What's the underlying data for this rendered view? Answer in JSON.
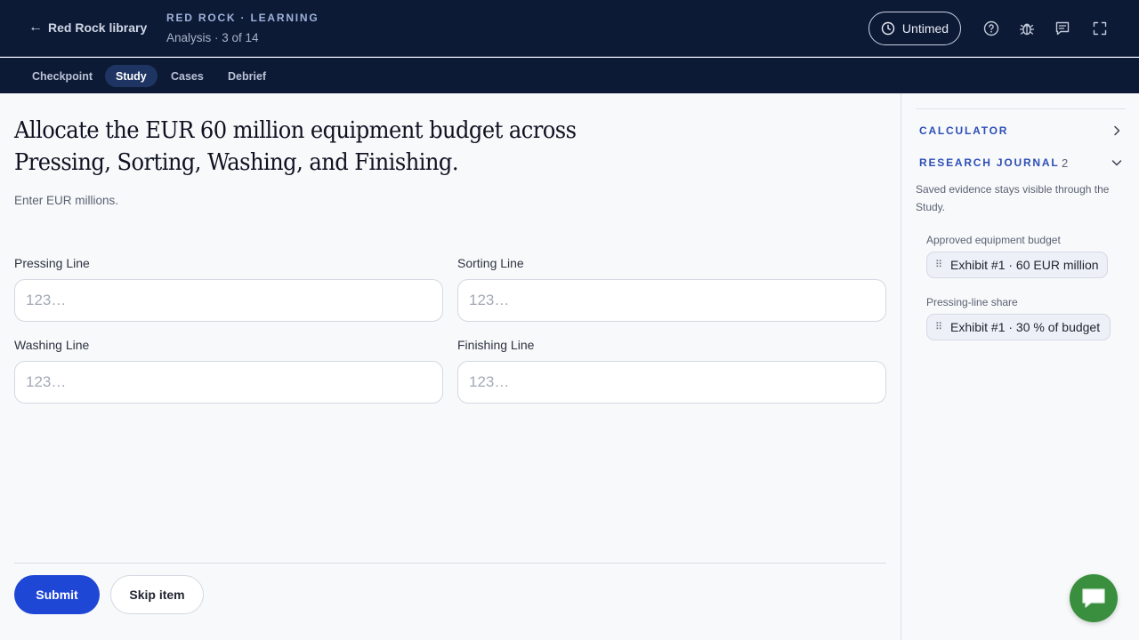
{
  "header": {
    "back_label": "Red Rock library",
    "brand": "RED ROCK · LEARNING",
    "subtitle": "Analysis · 3 of 14",
    "timer_label": "Untimed"
  },
  "header_icons": [
    "help-icon",
    "bug-icon",
    "feedback-icon",
    "fullscreen-icon"
  ],
  "tabs": [
    {
      "label": "Checkpoint",
      "active": false
    },
    {
      "label": "Study",
      "active": true
    },
    {
      "label": "Cases",
      "active": false
    },
    {
      "label": "Debrief",
      "active": false
    }
  ],
  "main": {
    "question": "Allocate the EUR 60 million equipment budget across Pressing, Sorting, Washing, and Finishing.",
    "hint": "Enter EUR millions.",
    "fields": [
      {
        "label": "Pressing Line",
        "placeholder": "123…",
        "value": ""
      },
      {
        "label": "Sorting Line",
        "placeholder": "123…",
        "value": ""
      },
      {
        "label": "Washing Line",
        "placeholder": "123…",
        "value": ""
      },
      {
        "label": "Finishing Line",
        "placeholder": "123…",
        "value": ""
      }
    ],
    "submit_label": "Submit",
    "skip_label": "Skip item"
  },
  "sidebar": {
    "calculator_label": "CALCULATOR",
    "journal_label": "RESEARCH JOURNAL",
    "journal_count": "2",
    "note": "Saved evidence stays visible through the Study.",
    "evidence": [
      {
        "label": "Approved equipment budget",
        "chip": "Exhibit #1 · 60 EUR million"
      },
      {
        "label": "Pressing-line share",
        "chip": "Exhibit #1 · 30 % of budget"
      }
    ]
  },
  "colors": {
    "header_bg": "#0d1a35",
    "active_tab_bg": "#1e3564",
    "accent_blue": "#1f47d6",
    "sidebar_heading": "#2d4fb5",
    "chat_green": "#3a8f3e"
  }
}
